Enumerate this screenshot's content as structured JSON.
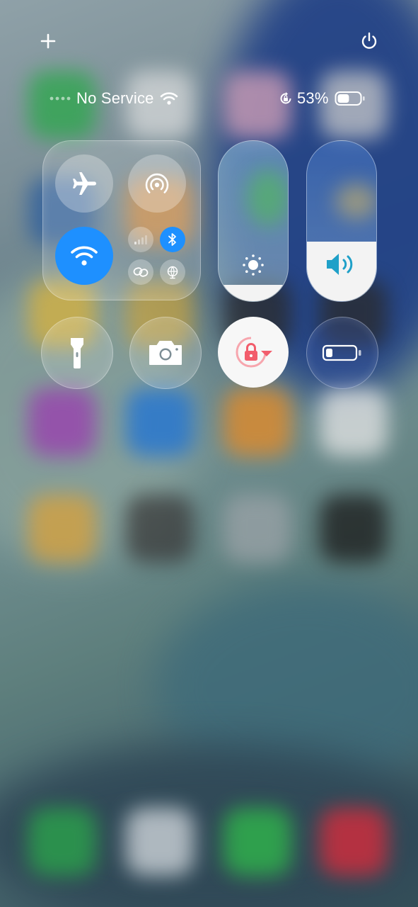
{
  "status_bar": {
    "carrier": "No Service",
    "battery_percent": "53%",
    "battery_level": 0.53
  },
  "top_controls": {
    "add_icon": "plus-icon",
    "power_icon": "power-icon"
  },
  "connectivity": {
    "airplane_mode": {
      "icon": "airplane-icon",
      "active": false
    },
    "hotspot": {
      "icon": "hotspot-icon",
      "active": false
    },
    "wifi": {
      "icon": "wifi-icon",
      "active": true,
      "color": "#1e90ff"
    },
    "cellular": {
      "icon": "cellular-signal-icon",
      "active": false
    },
    "bluetooth": {
      "icon": "bluetooth-icon",
      "active": true,
      "color": "#1e90ff"
    },
    "link": {
      "icon": "link-icon",
      "active": false
    },
    "vpn": {
      "icon": "globe-icon",
      "active": false
    }
  },
  "sliders": {
    "brightness": {
      "icon": "sun-icon",
      "level": 0.1
    },
    "volume": {
      "icon": "speaker-icon",
      "level": 0.37,
      "color": "#1fa0c8"
    }
  },
  "toggles": {
    "flashlight": {
      "icon": "flashlight-icon"
    },
    "camera": {
      "icon": "camera-icon"
    },
    "rotation_lock": {
      "icon": "rotation-lock-icon",
      "active": true,
      "color": "#f25d6c"
    },
    "battery_saver": {
      "icon": "battery-saver-icon"
    }
  }
}
